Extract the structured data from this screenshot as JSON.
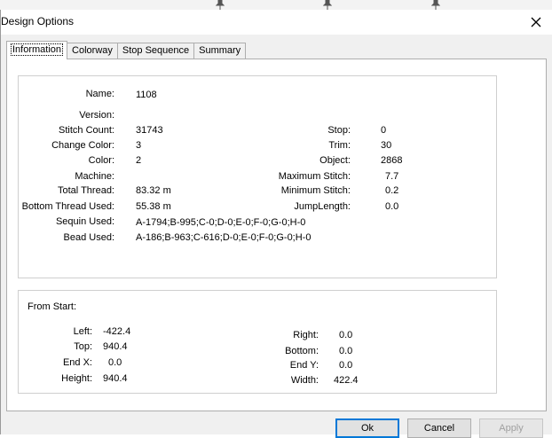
{
  "window": {
    "title": "Design Options"
  },
  "tabs": [
    {
      "label": "Information",
      "active": true
    },
    {
      "label": "Colorway",
      "active": false
    },
    {
      "label": "Stop Sequence",
      "active": false
    },
    {
      "label": "Summary",
      "active": false
    }
  ],
  "info": {
    "name": {
      "label": "Name:",
      "value": "1108"
    },
    "version": {
      "label": "Version:",
      "value": ""
    },
    "stitch_count": {
      "label": "Stitch Count:",
      "value": "31743"
    },
    "change_color": {
      "label": "Change Color:",
      "value": "3"
    },
    "color": {
      "label": "Color:",
      "value": "2"
    },
    "machine": {
      "label": "Machine:",
      "value": ""
    },
    "total_thread": {
      "label": "Total Thread:",
      "value": "83.32 m"
    },
    "bottom_thread": {
      "label": "Bottom Thread Used:",
      "value": "55.38 m"
    },
    "sequin": {
      "label": "Sequin Used:",
      "value": "A-1794;B-995;C-0;D-0;E-0;F-0;G-0;H-0"
    },
    "bead": {
      "label": "Bead Used:",
      "value": "A-186;B-963;C-616;D-0;E-0;F-0;G-0;H-0"
    },
    "stop": {
      "label": "Stop:",
      "value": "0"
    },
    "trim": {
      "label": "Trim:",
      "value": "30"
    },
    "object": {
      "label": "Object:",
      "value": "2868"
    },
    "max_stitch": {
      "label": "Maximum Stitch:",
      "value": "7.7"
    },
    "min_stitch": {
      "label": "Minimum Stitch:",
      "value": "0.2"
    },
    "jump_length": {
      "label": "JumpLength:",
      "value": "0.0"
    }
  },
  "from_start": {
    "heading": "From Start:",
    "left": {
      "label": "Left:",
      "value": "-422.4"
    },
    "top": {
      "label": "Top:",
      "value": "940.4"
    },
    "end_x": {
      "label": "End X:",
      "value": "0.0"
    },
    "height": {
      "label": "Height:",
      "value": "940.4"
    },
    "right": {
      "label": "Right:",
      "value": "0.0"
    },
    "bottom": {
      "label": "Bottom:",
      "value": "0.0"
    },
    "end_y": {
      "label": "End Y:",
      "value": "0.0"
    },
    "width": {
      "label": "Width:",
      "value": "422.4"
    }
  },
  "buttons": {
    "ok": "Ok",
    "cancel": "Cancel",
    "apply": "Apply"
  },
  "icons": {
    "close": "close-icon",
    "pin": "pin-icon"
  }
}
